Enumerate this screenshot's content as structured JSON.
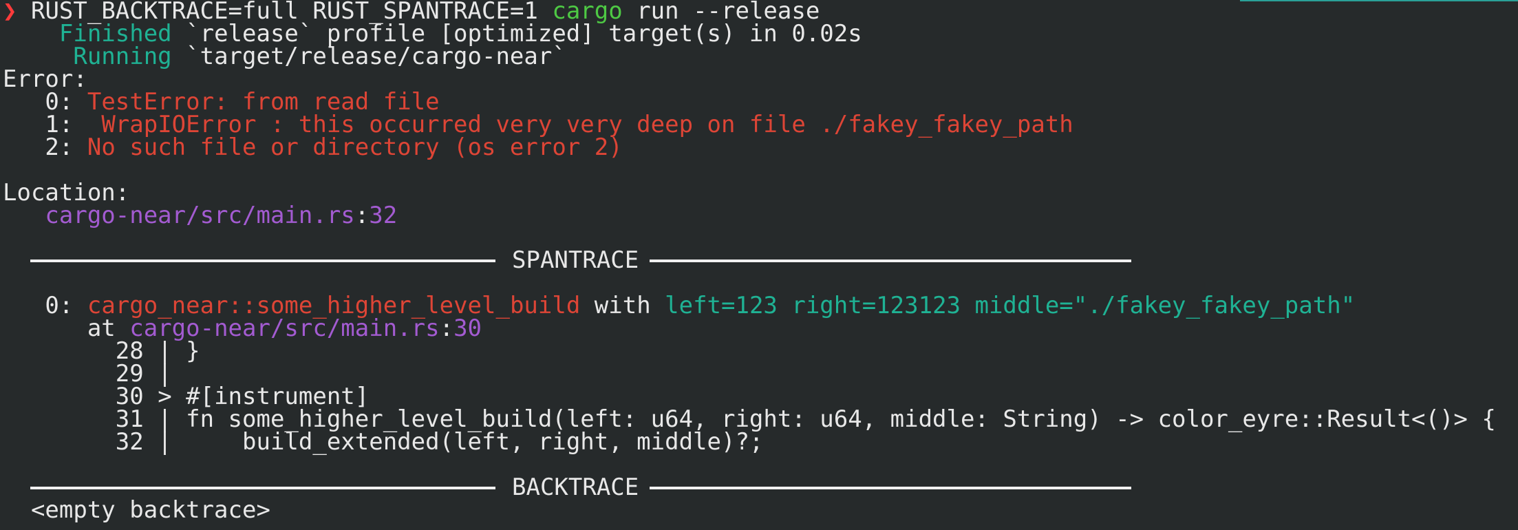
{
  "terminal": {
    "prompt_symbol": "❯",
    "command_env": "RUST_BACKTRACE=full RUST_SPANTRACE=1 ",
    "command_bin": "cargo",
    "command_args": " run --release",
    "finished_label": "Finished",
    "finished_text": " `release` profile [optimized] target(s) in 0.02s",
    "running_label": "Running",
    "running_text": " `target/release/cargo-near`",
    "error_header": "Error:",
    "errors": [
      {
        "index": "0:",
        "message": " TestError: from read file"
      },
      {
        "index": "1:",
        "message": "  WrapIOError : this occurred very very deep on file ./fakey_fakey_path"
      },
      {
        "index": "2:",
        "message": " No such file or directory (os error 2)"
      }
    ],
    "location_header": "Location:",
    "location": {
      "path": "cargo-near/src/main.rs",
      "sep": ":",
      "line": "32"
    },
    "spantrace_title": "SPANTRACE",
    "span": {
      "index": "0:",
      "fn_name": "cargo_near::some_higher_level_build",
      "with": " with ",
      "fields": "left=123 right=123123 middle=\"./fakey_fakey_path\"",
      "at": "at ",
      "path": "cargo-near/src/main.rs",
      "sep": ":",
      "line": "30"
    },
    "source_lines": [
      {
        "num": "28",
        "marker": " | ",
        "code": "}"
      },
      {
        "num": "29",
        "marker": " |",
        "code": ""
      },
      {
        "num": "30",
        "marker": " > ",
        "code": "#[instrument]"
      },
      {
        "num": "31",
        "marker": " | ",
        "code": "fn some_higher_level_build(left: u64, right: u64, middle: String) -> color_eyre::Result<()> {"
      },
      {
        "num": "32",
        "marker": " | ",
        "code": "    build_extended(left, right, middle)?;"
      }
    ],
    "backtrace_title": "BACKTRACE",
    "backtrace_empty": "<empty backtrace>"
  },
  "colors": {
    "background": "#262a2b",
    "text": "#e8e8e8",
    "error_red": "#dd4536",
    "success_green": "#4ec944",
    "field_teal": "#1fb294",
    "path_purple": "#a35bd1"
  }
}
